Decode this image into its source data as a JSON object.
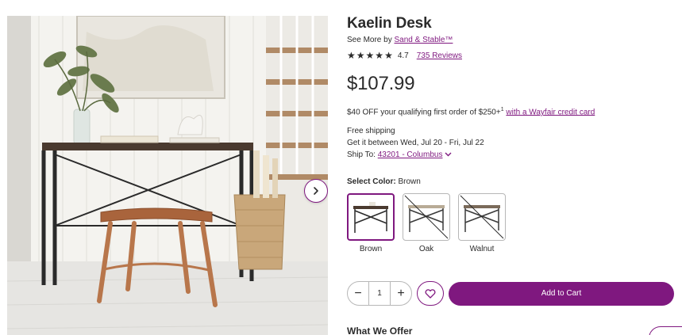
{
  "product": {
    "title": "Kaelin Desk",
    "see_more_prefix": "See More by",
    "brand": "Sand & Stable™",
    "rating_value": "4.7",
    "rating_stars": 4.7,
    "reviews_label": "735 Reviews",
    "price": "$107.99"
  },
  "promo": {
    "text": "$40 OFF your qualifying first order of $250+",
    "sup": "1",
    "link": "with a Wayfair credit card"
  },
  "shipping": {
    "line1": "Free shipping",
    "line2": "Get it between Wed, Jul 20 - Fri, Jul 22",
    "ship_to_label": "Ship To:",
    "ship_to_value": "43201 - Columbus"
  },
  "color": {
    "label": "Select Color:",
    "selected": "Brown",
    "options": [
      {
        "name": "Brown",
        "available": true
      },
      {
        "name": "Oak",
        "available": false
      },
      {
        "name": "Walnut",
        "available": false
      }
    ]
  },
  "cart": {
    "minus": "−",
    "quantity": "1",
    "plus": "+",
    "add_label": "Add to Cart"
  },
  "section": {
    "what_we_offer": "What We Offer"
  },
  "colors": {
    "accent": "#7f187f",
    "text": "#2b2b2b",
    "border": "#b7b7b7"
  },
  "icons": {
    "next": "chevron-right-icon",
    "favorite": "heart-icon",
    "star": "star-icon",
    "dropdown": "chevron-down-icon"
  }
}
